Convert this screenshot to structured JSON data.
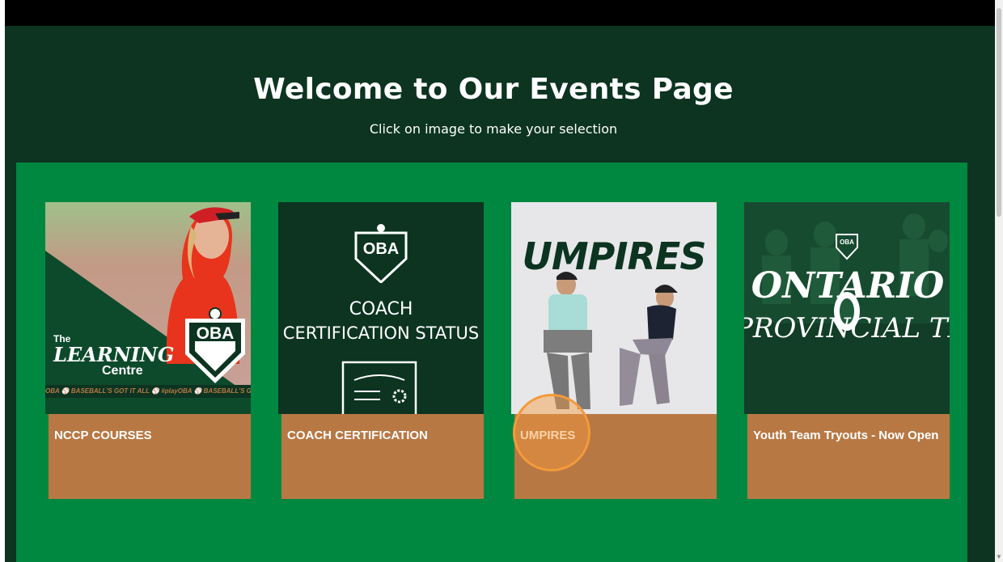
{
  "hero": {
    "title": "Welcome to Our Events Page",
    "subtitle": "Click on image to make your selection"
  },
  "cards": [
    {
      "label": "NCCP COURSES",
      "image": {
        "the": "The",
        "learning": "LEARNING",
        "centre": "Centre",
        "logo": "OBA",
        "ribbon": "OBA ⚾ BASEBALL'S GOT IT ALL ⚾ #playOBA ⚾ BASEBALL'S GOT IT ALL"
      }
    },
    {
      "label": "COACH CERTIFICATION",
      "image": {
        "logo": "OBA",
        "line1": "COACH",
        "line2": "CERTIFICATION STATUS"
      }
    },
    {
      "label": "UMPIRES",
      "image": {
        "headline": "UMPIRES"
      }
    },
    {
      "label": "Youth Team Tryouts - Now Open",
      "image": {
        "logo": "OBA",
        "line1": "ONTARIO",
        "line2": "PROVINCIAL TEAM"
      }
    }
  ],
  "colors": {
    "page_bg": "#0c3421",
    "panel_bg": "#008840",
    "label_bg": "#b87844",
    "cursor": "#f49a3b"
  },
  "icons": [
    "oba-shield-icon",
    "certificate-icon",
    "cursor-click-indicator"
  ]
}
